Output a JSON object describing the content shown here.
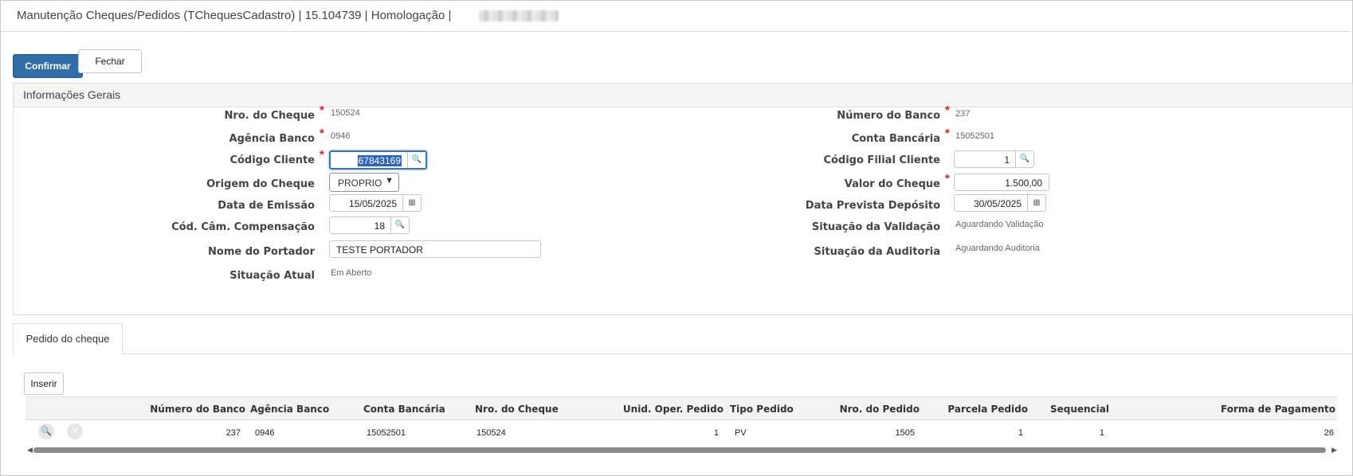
{
  "window": {
    "title": "Manutenção Cheques/Pedidos (TChequesCadastro) | 15.104739 | Homologação |"
  },
  "toolbar": {
    "confirm_label": "Confirmar",
    "close_label": "Fechar"
  },
  "general": {
    "section_title": "Informações Gerais",
    "nro_cheque_label": "Nro. do Cheque",
    "nro_cheque_value": "150524",
    "agencia_label": "Agência Banco",
    "agencia_value": "0946",
    "codigo_cliente_label": "Código Cliente",
    "codigo_cliente_value": "67843169",
    "origem_label": "Origem do Cheque",
    "origem_value": "PROPRIO",
    "data_emissao_label": "Data de Emissão",
    "data_emissao_value": "15/05/2025",
    "cod_cam_label": "Cód. Câm. Compensação",
    "cod_cam_value": "18",
    "nome_portador_label": "Nome do Portador",
    "nome_portador_value": "TESTE PORTADOR",
    "situacao_atual_label": "Situação Atual",
    "situacao_atual_value": "Em Aberto",
    "numero_banco_label": "Número do Banco",
    "numero_banco_value": "237",
    "conta_label": "Conta Bancária",
    "conta_value": "15052501",
    "codigo_filial_label": "Código Filial Cliente",
    "codigo_filial_value": "1",
    "valor_label": "Valor do Cheque",
    "valor_value": "1.500,00",
    "data_prevista_label": "Data Prevista Depósito",
    "data_prevista_value": "30/05/2025",
    "sit_validacao_label": "Situação da Validação",
    "sit_validacao_value": "Aguardando Validação",
    "sit_auditoria_label": "Situação da Auditoria",
    "sit_auditoria_value": "Aguardando Auditoria",
    "required_mark": "*"
  },
  "tab": {
    "label": "Pedido do cheque",
    "insert_label": "Inserir"
  },
  "grid": {
    "headers": [
      "Número do Banco",
      "Agência Banco",
      "Conta Bancária",
      "Nro. do Cheque",
      "Unid. Oper. Pedido",
      "Tipo Pedido",
      "Nro. do Pedido",
      "Parcela Pedido",
      "Sequencial",
      "Forma de Pagamento"
    ],
    "rows": [
      [
        "237",
        "0946",
        "15052501",
        "150524",
        "1",
        "PV",
        "1505",
        "1",
        "1",
        "26"
      ]
    ]
  },
  "icons": {
    "search": "search-icon",
    "calendar": "calendar-icon",
    "close": "close-icon",
    "chevron": "chevron-down-icon"
  }
}
